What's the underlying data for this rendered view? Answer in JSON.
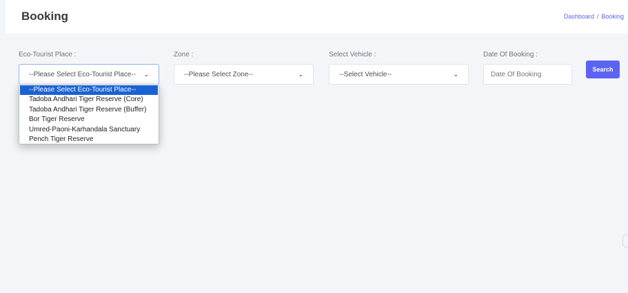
{
  "header": {
    "title": "Booking",
    "breadcrumb": {
      "home": "Dashboard",
      "separator": "/",
      "current": "Booking"
    }
  },
  "filters": {
    "place": {
      "label": "Eco-Tourist Place :",
      "selected": "--Please Select Eco-Tourist Place--",
      "options": [
        "--Please Select Eco-Tourist Place--",
        "Tadoba Andhari Tiger Reserve (Core)",
        "Tadoba Andhari Tiger Reserve (Buffer)",
        "Bor Tiger Reserve",
        "Umred-Paoni-Karhandala Sanctuary",
        "Pench Tiger Reserve"
      ]
    },
    "zone": {
      "label": "Zone :",
      "selected": "--Please Select Zone--"
    },
    "vehicle": {
      "label": "Select Vehicle :",
      "selected": "--Select Vehicle--"
    },
    "date": {
      "label": "Date Of Booking :",
      "placeholder": "Date Of Booking"
    },
    "search_label": "Search"
  },
  "colors": {
    "accent": "#5b63f2",
    "selected_option": "#1a62d4"
  }
}
